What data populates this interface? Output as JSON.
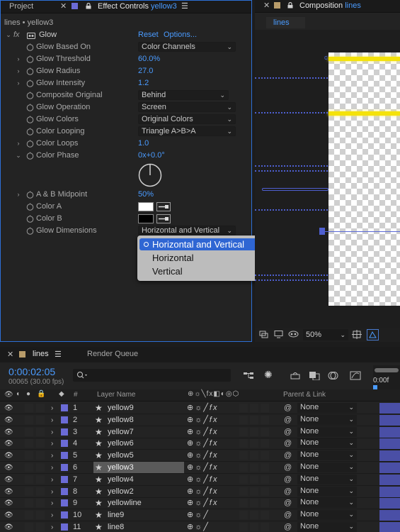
{
  "effect_panel": {
    "tab_project": "Project",
    "tab_effect_controls": "Effect Controls",
    "tab_effect_target": "yellow3",
    "breadcrumb": "lines • yellow3",
    "effect_name": "Glow",
    "reset_label": "Reset",
    "options_label": "Options...",
    "params": [
      {
        "label": "Glow Based On",
        "value": "Color Channels",
        "kind": "dropdown"
      },
      {
        "label": "Glow Threshold",
        "value": "60.0%",
        "kind": "value"
      },
      {
        "label": "Glow Radius",
        "value": "27.0",
        "kind": "value"
      },
      {
        "label": "Glow Intensity",
        "value": "1.2",
        "kind": "value"
      },
      {
        "label": "Composite Original",
        "value": "Behind",
        "kind": "dropdown"
      },
      {
        "label": "Glow Operation",
        "value": "Screen",
        "kind": "dropdown"
      },
      {
        "label": "Glow Colors",
        "value": "Original Colors",
        "kind": "dropdown"
      },
      {
        "label": "Color Looping",
        "value": "Triangle A>B>A",
        "kind": "dropdown"
      },
      {
        "label": "Color Loops",
        "value": "1.0",
        "kind": "value"
      },
      {
        "label": "Color Phase",
        "value": "0x+0.0°",
        "kind": "value"
      },
      {
        "label": "A & B Midpoint",
        "value": "50%",
        "kind": "value"
      },
      {
        "label": "Color A",
        "value": "#ffffff",
        "kind": "color"
      },
      {
        "label": "Color B",
        "value": "#000000",
        "kind": "color"
      },
      {
        "label": "Glow Dimensions",
        "value": "Horizontal and Vertical",
        "kind": "dropdown"
      }
    ],
    "popup_options": [
      "Horizontal and Vertical",
      "Horizontal",
      "Vertical"
    ],
    "popup_selected": "Horizontal and Vertical"
  },
  "comp_panel": {
    "tab_label": "Composition",
    "comp_name": "lines",
    "subtab": "lines",
    "zoom": "50%"
  },
  "timeline": {
    "comp_tab": "lines",
    "render_queue_tab": "Render Queue",
    "timecode": "0:00:02:05",
    "frame_info": "00065 (30.00 fps)",
    "search_placeholder": "",
    "col_num": "#",
    "col_layer_name": "Layer Name",
    "col_parent": "Parent & Link",
    "ruler_start": "0:00f",
    "layers": [
      {
        "num": "1",
        "name": "yellow9",
        "parent": "None",
        "fx": true
      },
      {
        "num": "2",
        "name": "yellow8",
        "parent": "None",
        "fx": true
      },
      {
        "num": "3",
        "name": "yellow7",
        "parent": "None",
        "fx": true
      },
      {
        "num": "4",
        "name": "yellow6",
        "parent": "None",
        "fx": true
      },
      {
        "num": "5",
        "name": "yellow5",
        "parent": "None",
        "fx": true
      },
      {
        "num": "6",
        "name": "yellow3",
        "parent": "None",
        "fx": true,
        "selected": true
      },
      {
        "num": "7",
        "name": "yellow4",
        "parent": "None",
        "fx": true
      },
      {
        "num": "8",
        "name": "yellow2",
        "parent": "None",
        "fx": true
      },
      {
        "num": "9",
        "name": "yellowline",
        "parent": "None",
        "fx": true
      },
      {
        "num": "10",
        "name": "line9",
        "parent": "None",
        "fx": false
      },
      {
        "num": "11",
        "name": "line8",
        "parent": "None",
        "fx": false
      }
    ]
  },
  "colors": {
    "accent_blue": "#4a9bff",
    "label_violet": "#6b6bd6",
    "selection_blue": "#2f66d3",
    "glow_yellow": "#f4e20a"
  }
}
